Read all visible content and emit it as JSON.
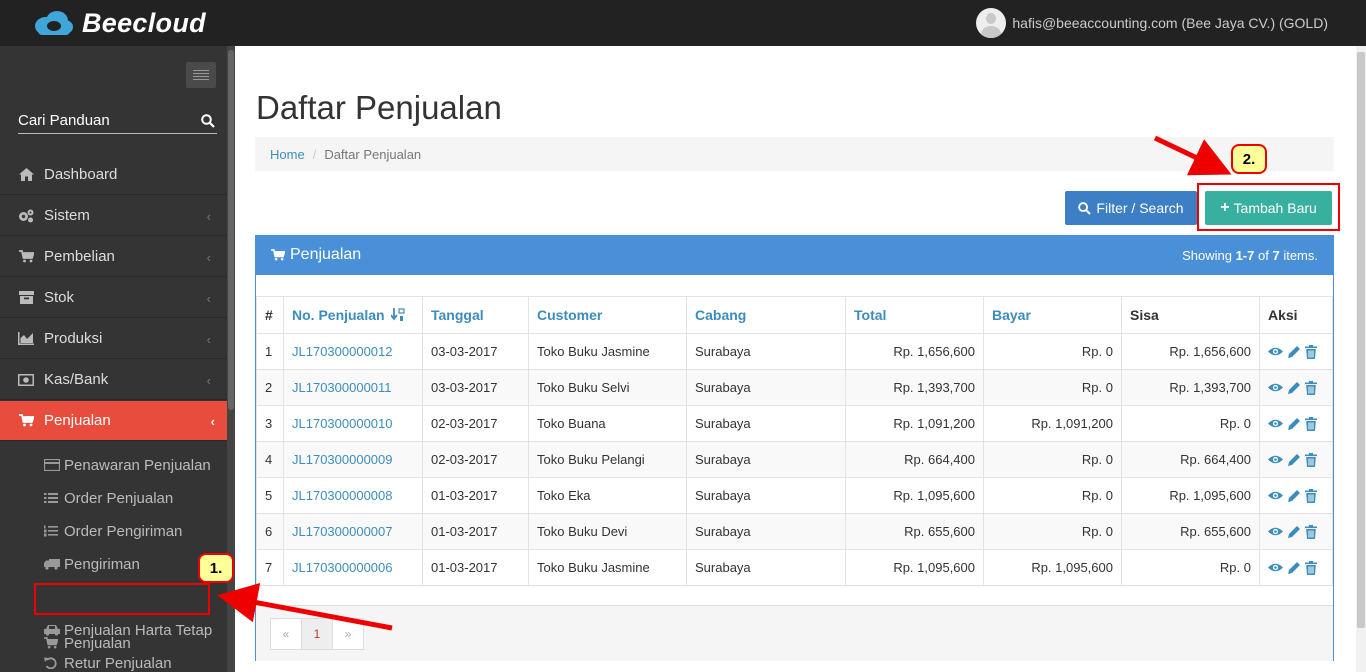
{
  "app": {
    "brand": "Beecloud",
    "user": "hafis@beeaccounting.com (Bee Jaya CV.) (GOLD)"
  },
  "sidebar": {
    "search_placeholder": "Cari Panduan",
    "items": [
      {
        "label": "Dashboard",
        "icon": "home-icon"
      },
      {
        "label": "Sistem",
        "icon": "gears-icon"
      },
      {
        "label": "Pembelian",
        "icon": "cart-icon"
      },
      {
        "label": "Stok",
        "icon": "box-icon"
      },
      {
        "label": "Produksi",
        "icon": "chart-icon"
      },
      {
        "label": "Kas/Bank",
        "icon": "money-icon"
      },
      {
        "label": "Penjualan",
        "icon": "cart-icon"
      }
    ],
    "submenu": [
      {
        "label": "Penawaran Penjualan",
        "icon": "credit-card-icon"
      },
      {
        "label": "Order Penjualan",
        "icon": "list-icon"
      },
      {
        "label": "Order Pengiriman",
        "icon": "list-ol-icon"
      },
      {
        "label": "Pengiriman",
        "icon": "truck-icon"
      },
      {
        "label": "Penjualan",
        "icon": "cart-icon"
      },
      {
        "label": "Penjualan Harta Tetap",
        "icon": "car-icon"
      },
      {
        "label": "Retur Penjualan",
        "icon": "undo-icon"
      }
    ]
  },
  "page": {
    "title": "Daftar Penjualan",
    "breadcrumb_home": "Home",
    "breadcrumb_sep": "/",
    "breadcrumb_current": "Daftar Penjualan",
    "filter_label": "Filter / Search",
    "add_label": "Tambah Baru",
    "add_plus": "+"
  },
  "panel": {
    "title": "Penjualan",
    "summary_prefix": "Showing",
    "summary_range": "1-7",
    "summary_of": "of",
    "summary_total": "7",
    "summary_suffix": "items."
  },
  "table": {
    "headers": [
      "#",
      "No. Penjualan",
      "Tanggal",
      "Customer",
      "Cabang",
      "Total",
      "Bayar",
      "Sisa",
      "Aksi"
    ],
    "rows": [
      [
        "1",
        "JL170300000012",
        "03-03-2017",
        "Toko Buku Jasmine",
        "Surabaya",
        "Rp. 1,656,600",
        "Rp. 0",
        "Rp. 1,656,600"
      ],
      [
        "2",
        "JL170300000011",
        "03-03-2017",
        "Toko Buku Selvi",
        "Surabaya",
        "Rp. 1,393,700",
        "Rp. 0",
        "Rp. 1,393,700"
      ],
      [
        "3",
        "JL170300000010",
        "02-03-2017",
        "Toko Buana",
        "Surabaya",
        "Rp. 1,091,200",
        "Rp. 1,091,200",
        "Rp. 0"
      ],
      [
        "4",
        "JL170300000009",
        "02-03-2017",
        "Toko Buku Pelangi",
        "Surabaya",
        "Rp. 664,400",
        "Rp. 0",
        "Rp. 664,400"
      ],
      [
        "5",
        "JL170300000008",
        "01-03-2017",
        "Toko Eka",
        "Surabaya",
        "Rp. 1,095,600",
        "Rp. 0",
        "Rp. 1,095,600"
      ],
      [
        "6",
        "JL170300000007",
        "01-03-2017",
        "Toko Buku Devi",
        "Surabaya",
        "Rp. 655,600",
        "Rp. 0",
        "Rp. 655,600"
      ],
      [
        "7",
        "JL170300000006",
        "01-03-2017",
        "Toko Buku Jasmine",
        "Surabaya",
        "Rp. 1,095,600",
        "Rp. 1,095,600",
        "Rp. 0"
      ]
    ]
  },
  "pagination": {
    "prev": "«",
    "current": "1",
    "next": "»"
  },
  "annotations": {
    "step1": "1.",
    "step2": "2."
  },
  "colors": {
    "accent": "#e74c3c",
    "primary": "#4a90d9",
    "success": "#38b09f",
    "link": "#3c8dbc"
  }
}
